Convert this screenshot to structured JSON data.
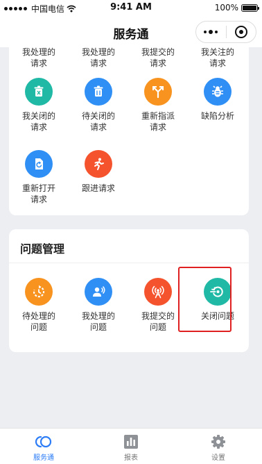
{
  "status_bar": {
    "carrier": "中国电信",
    "time": "9:41 AM",
    "battery": "100%"
  },
  "nav": {
    "title": "服务通"
  },
  "request_section": {
    "cut_items": [
      {
        "label": "我处理的\n请求"
      },
      {
        "label": "我处理的\n请求"
      },
      {
        "label": "我提交的\n请求"
      },
      {
        "label": "我关注的\n请求"
      }
    ],
    "items": [
      {
        "label": "我关闭的\n请求",
        "icon": "trash-icon",
        "color": "#1fb9a5"
      },
      {
        "label": "待关闭的\n请求",
        "icon": "trash-icon",
        "color": "#2f8ff5"
      },
      {
        "label": "重新指派\n请求",
        "icon": "reassign-icon",
        "color": "#f7931e"
      },
      {
        "label": "缺陷分析",
        "icon": "bug-icon",
        "color": "#2f8ff5"
      },
      {
        "label": "重新打开\n请求",
        "icon": "reopen-icon",
        "color": "#2f8ff5"
      },
      {
        "label": "跟进请求",
        "icon": "runner-icon",
        "color": "#f5532d"
      }
    ]
  },
  "issue_section": {
    "title": "问题管理",
    "items": [
      {
        "label": "待处理的\n问题",
        "icon": "pending-icon",
        "color": "#f7931e"
      },
      {
        "label": "我处理的\n问题",
        "icon": "user-voice-icon",
        "color": "#2f8ff5"
      },
      {
        "label": "我提交的\n问题",
        "icon": "signal-icon",
        "color": "#f5532d"
      },
      {
        "label": "关闭问题",
        "icon": "close-issue-icon",
        "color": "#1fb9a5"
      }
    ]
  },
  "tabs": [
    {
      "label": "服务通",
      "icon": "home-ring-icon",
      "active": true
    },
    {
      "label": "报表",
      "icon": "chart-icon",
      "active": false
    },
    {
      "label": "设置",
      "icon": "gear-icon",
      "active": false
    }
  ],
  "colors": {
    "accent": "#2b7cf6",
    "highlight": "#e02020"
  }
}
